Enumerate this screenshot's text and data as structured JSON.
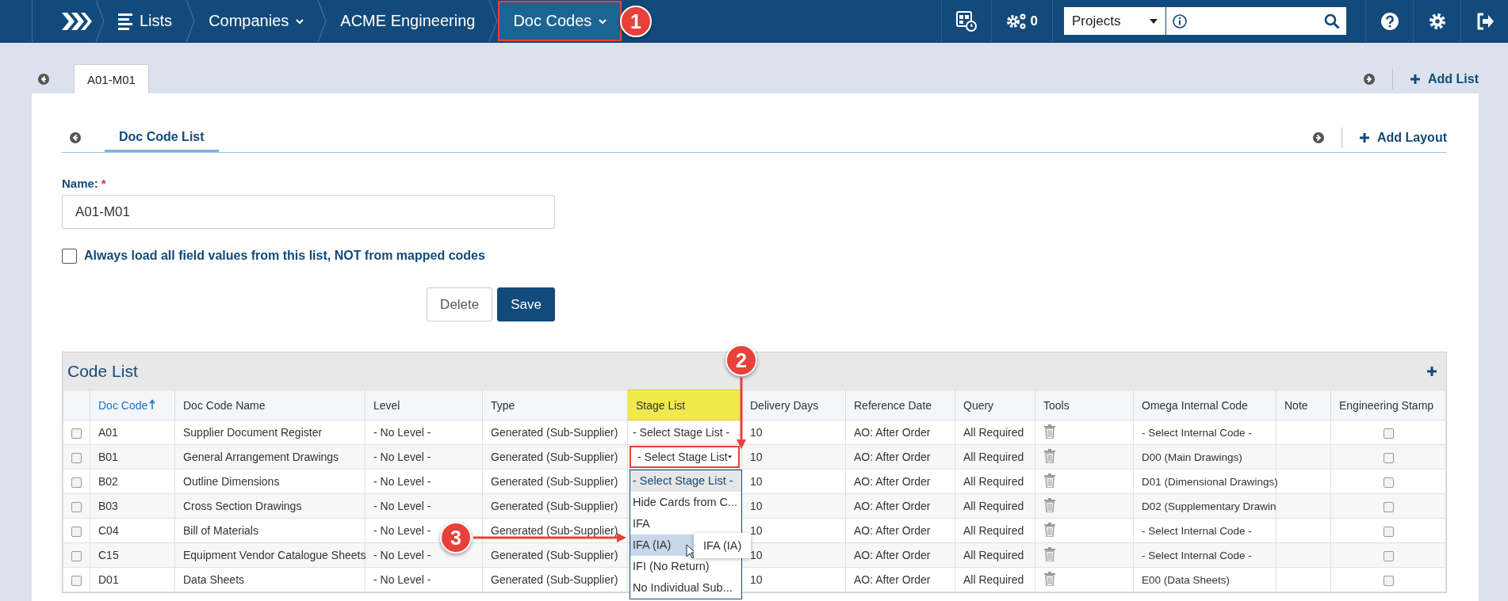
{
  "breadcrumbs": [
    {
      "label": "Lists",
      "kind": "list",
      "selected": false,
      "outlined": false
    },
    {
      "label": "Companies",
      "kind": "menu",
      "selected": false,
      "outlined": false
    },
    {
      "label": "ACME Engineering",
      "kind": "plain",
      "selected": false,
      "outlined": false
    },
    {
      "label": "Doc Codes",
      "kind": "menu",
      "selected": true,
      "outlined": true
    }
  ],
  "toolbar": {
    "job_count": "0",
    "scope": "Projects"
  },
  "list_tabs": [
    {
      "label": "A01-M01",
      "selected": true
    }
  ],
  "add_list": "Add List",
  "layout_tabs": [
    {
      "label": "Doc Code List",
      "selected": true
    }
  ],
  "add_layout": "Add Layout",
  "form": {
    "name_label": "Name:",
    "required_mark": "*",
    "name_value": "A01-M01",
    "always_load": {
      "label": "Always load all field values from this list, NOT from mapped codes",
      "checked": false
    },
    "buttons": [
      {
        "label": "Delete",
        "kind": "secondary"
      },
      {
        "label": "Save",
        "kind": "primary"
      }
    ]
  },
  "code_list": {
    "title": "Code List",
    "columns": [
      {
        "label": "Doc Code",
        "sorted": true,
        "highlighted": false
      },
      {
        "label": "Doc Code Name",
        "sorted": false,
        "highlighted": false
      },
      {
        "label": "Level",
        "sorted": false,
        "highlighted": false
      },
      {
        "label": "Type",
        "sorted": false,
        "highlighted": false
      },
      {
        "label": "Stage List",
        "sorted": false,
        "highlighted": true
      },
      {
        "label": "Delivery Days",
        "sorted": false,
        "highlighted": false
      },
      {
        "label": "Reference Date",
        "sorted": false,
        "highlighted": false
      },
      {
        "label": "Query",
        "sorted": false,
        "highlighted": false
      },
      {
        "label": "Tools",
        "sorted": false,
        "highlighted": false
      },
      {
        "label": "Omega Internal Code",
        "sorted": false,
        "highlighted": false
      },
      {
        "label": "Note",
        "sorted": false,
        "highlighted": false
      },
      {
        "label": "Engineering Stamp",
        "sorted": false,
        "highlighted": false
      }
    ],
    "rows": [
      {
        "checked": false,
        "code": "A01",
        "name": "Supplier Document Register",
        "level": "- No Level -",
        "type": "Generated (Sub-Supplier)",
        "stage": {
          "kind": "text",
          "label": "- Select Stage List -"
        },
        "delivery": "10",
        "reference": "AO: After Order",
        "query": "All Required",
        "internal": "- Select Internal Code -",
        "stamp": false
      },
      {
        "checked": false,
        "code": "B01",
        "name": "General Arrangement Drawings",
        "level": "- No Level -",
        "type": "Generated (Sub-Supplier)",
        "stage": {
          "kind": "select",
          "label": "- Select Stage List",
          "outlined": true,
          "open": true,
          "options": [
            {
              "label": "- Select Stage List -",
              "selected": true,
              "hovered": false
            },
            {
              "label": "Hide Cards from C...",
              "selected": false,
              "hovered": false
            },
            {
              "label": "IFA",
              "selected": false,
              "hovered": false
            },
            {
              "label": "IFA (IA)",
              "selected": false,
              "hovered": true
            },
            {
              "label": "IFI (No Return)",
              "selected": false,
              "hovered": false
            },
            {
              "label": "No Individual Sub...",
              "selected": false,
              "hovered": false
            }
          ],
          "tooltip": "IFA (IA)"
        },
        "delivery": "10",
        "reference": "AO: After Order",
        "query": "All Required",
        "internal": "D00 (Main Drawings)",
        "stamp": false
      },
      {
        "checked": false,
        "code": "B02",
        "name": "Outline Dimensions",
        "level": "- No Level -",
        "type": "Generated (Sub-Supplier)",
        "stage": {
          "kind": "hidden"
        },
        "delivery": "10",
        "reference": "AO: After Order",
        "query": "All Required",
        "internal": "D01 (Dimensional Drawings)",
        "stamp": false
      },
      {
        "checked": false,
        "code": "B03",
        "name": "Cross Section Drawings",
        "level": "- No Level -",
        "type": "Generated (Sub-Supplier)",
        "stage": {
          "kind": "hidden"
        },
        "delivery": "10",
        "reference": "AO: After Order",
        "query": "All Required",
        "internal": "D02 (Supplementary Drawin",
        "stamp": false
      },
      {
        "checked": false,
        "code": "C04",
        "name": "Bill of Materials",
        "level": "- No Level -",
        "type": "Generated (Sub-Supplier)",
        "stage": {
          "kind": "hidden"
        },
        "delivery": "10",
        "reference": "AO: After Order",
        "query": "All Required",
        "internal": "- Select Internal Code -",
        "stamp": false
      },
      {
        "checked": false,
        "code": "C15",
        "name": "Equipment Vendor Catalogue Sheets",
        "level": "- No Level -",
        "type": "Generated (Sub-Supplier)",
        "stage": {
          "kind": "hidden"
        },
        "delivery": "10",
        "reference": "AO: After Order",
        "query": "All Required",
        "internal": "- Select Internal Code -",
        "stamp": false
      },
      {
        "checked": false,
        "code": "D01",
        "name": "Data Sheets",
        "level": "- No Level -",
        "type": "Generated (Sub-Supplier)",
        "stage": {
          "kind": "hidden"
        },
        "delivery": "10",
        "reference": "AO: After Order",
        "query": "All Required",
        "internal": "E00 (Data Sheets)",
        "stamp": false
      }
    ]
  },
  "annotations": [
    {
      "number": "1"
    },
    {
      "number": "2"
    },
    {
      "number": "3"
    }
  ]
}
